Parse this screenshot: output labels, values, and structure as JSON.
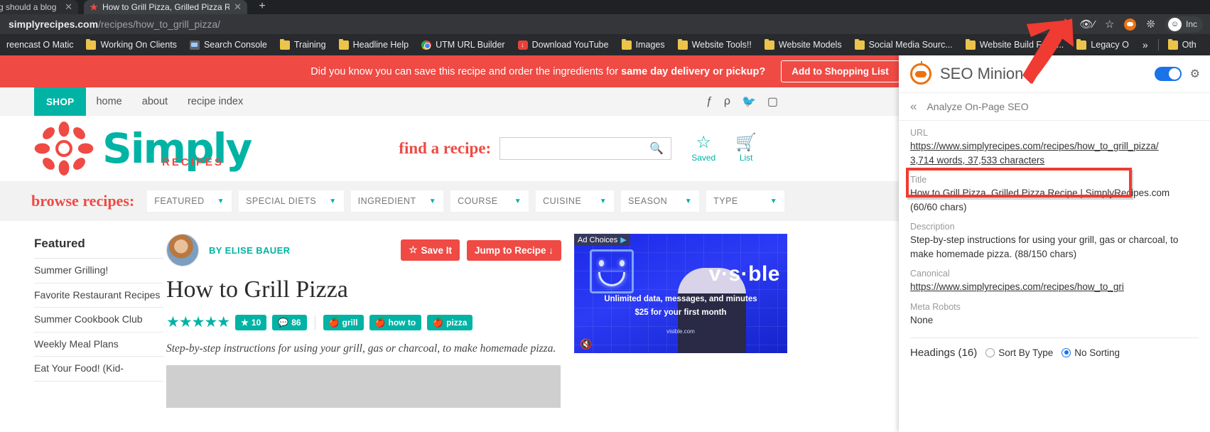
{
  "browser": {
    "tabs": [
      {
        "title": "g should a blog",
        "active": false,
        "close_label": "✕"
      },
      {
        "title": "How to Grill Pizza, Grilled Pizza R",
        "active": true,
        "close_label": "✕"
      }
    ],
    "new_tab_label": "+",
    "url_domain": "simplyrecipes.com",
    "url_path": "/recipes/how_to_grill_pizza/",
    "omni_icons": [
      "eye-slash-icon",
      "star-icon",
      "seo-minion-icon",
      "extensions-icon"
    ],
    "incognito_label": "Inc",
    "bookmarks": [
      {
        "label": "reencast O Matic",
        "icon": "none"
      },
      {
        "label": "Working On Clients",
        "icon": "folder"
      },
      {
        "label": "Search Console",
        "icon": "gsc"
      },
      {
        "label": "Training",
        "icon": "folder"
      },
      {
        "label": "Headline Help",
        "icon": "folder"
      },
      {
        "label": "UTM URL Builder",
        "icon": "chrome"
      },
      {
        "label": "Download YouTube",
        "icon": "download"
      },
      {
        "label": "Images",
        "icon": "folder"
      },
      {
        "label": "Website Tools!!",
        "icon": "folder"
      },
      {
        "label": "Website Models",
        "icon": "folder"
      },
      {
        "label": "Social Media Sourc...",
        "icon": "folder"
      },
      {
        "label": "Website Build Foun...",
        "icon": "folder"
      },
      {
        "label": "Legacy O",
        "icon": "folder"
      }
    ],
    "bookmarks_overflow": "»",
    "other_bookmarks": "Oth"
  },
  "promo": {
    "text_before": "Did you know you can save this recipe and order the ingredients for",
    "text_bold": "same day delivery or pickup?",
    "button": "Add to Shopping List"
  },
  "topnav": {
    "shop": "SHOP",
    "links": [
      "home",
      "about",
      "recipe index"
    ],
    "social": [
      "facebook-icon",
      "pinterest-icon",
      "twitter-icon",
      "instagram-icon"
    ]
  },
  "header": {
    "logo_primary": "Simply",
    "logo_secondary": "RECIPES",
    "find_label": "find a recipe:",
    "search_placeholder": "",
    "search_value": "",
    "saved_label": "Saved",
    "list_label": "List"
  },
  "browse": {
    "label": "browse recipes:",
    "dropdowns": [
      "FEATURED",
      "SPECIAL DIETS",
      "INGREDIENT",
      "COURSE",
      "CUISINE",
      "SEASON",
      "TYPE"
    ]
  },
  "sidebar": {
    "title": "Featured",
    "items": [
      "Summer Grilling!",
      "Favorite Restaurant Recipes",
      "Summer Cookbook Club",
      "Weekly Meal Plans",
      "Eat Your Food! (Kid-"
    ]
  },
  "article": {
    "byline": "BY ELISE BAUER",
    "save_button": "Save It",
    "jump_button": "Jump to Recipe ↓",
    "title": "How to Grill Pizza",
    "stars": "★★★★★",
    "rating_count": "10",
    "comment_count": "86",
    "tags": [
      "grill",
      "how to",
      "pizza"
    ],
    "dek": "Step-by-step instructions for using your grill, gas or charcoal, to make homemade pizza."
  },
  "ad": {
    "choices_label": "Ad Choices",
    "brand": "v·s·ble",
    "line1": "Unlimited data, messages, and minutes",
    "line2": "$25 for your first month",
    "url": "visible.com"
  },
  "seo": {
    "app_name": "SEO Minion",
    "toggle_on": true,
    "back_chevron": "«",
    "section_title": "Analyze On-Page SEO",
    "url_label": "URL",
    "url_value": "https://www.simplyrecipes.com/recipes/how_to_grill_pizza/",
    "word_count": "3,714 words, 37,533 characters",
    "title_label": "Title",
    "title_value": "How to Grill Pizza, Grilled Pizza Recipe | SimplyRecipes.com (60/60 chars)",
    "description_label": "Description",
    "description_value": "Step-by-step instructions for using your grill, gas or charcoal, to make homemade pizza. (88/150 chars)",
    "canonical_label": "Canonical",
    "canonical_value": "https://www.simplyrecipes.com/recipes/how_to_gri",
    "meta_robots_label": "Meta Robots",
    "meta_robots_value": "None",
    "headings_label": "Headings (16)",
    "sort_by_type_label": "Sort By Type",
    "no_sorting_label": "No Sorting",
    "sort_selected": "No Sorting",
    "highlight_color": "#ef3b32"
  }
}
